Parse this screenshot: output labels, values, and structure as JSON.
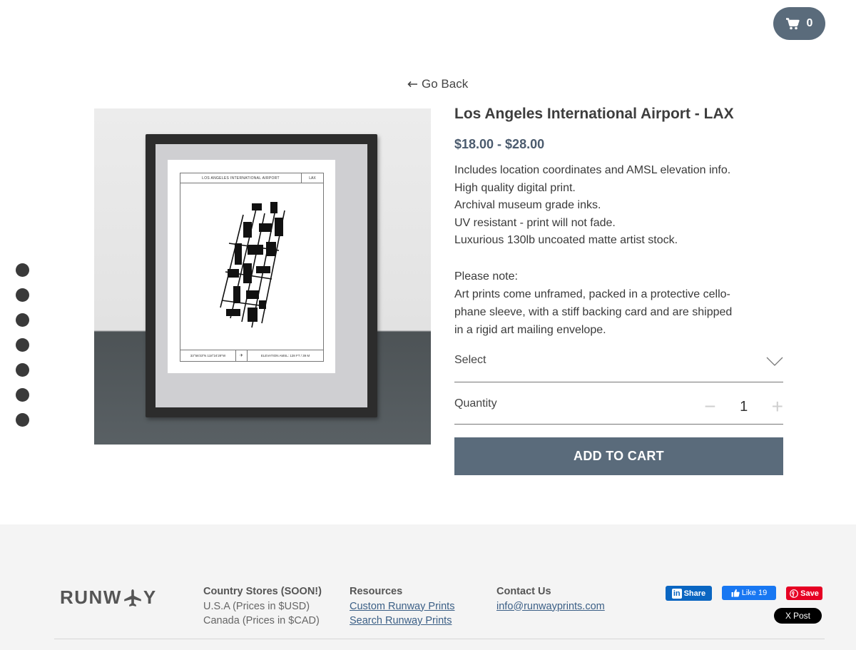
{
  "header": {
    "cart_count": "0"
  },
  "nav": {
    "go_back_label": "Go Back"
  },
  "product": {
    "title": "Los Angeles International Airport - LAX",
    "price": "$18.00 - $28.00",
    "description": [
      "Includes location coordinates and AMSL elevation info.",
      "High quality digital print.",
      "Archival museum grade inks.",
      "UV resistant - print will not fade.",
      "Luxurious 130lb uncoated matte artist stock."
    ],
    "note_heading": "Please note:",
    "note_lines": [
      "Art prints come unframed, packed in a protective cello-",
      "phane sleeve, with a stiff backing card and are shipped",
      "in a rigid art mailing envelope."
    ],
    "print": {
      "header_title": "LOS ANGELES INTERNATIONAL AIRPORT",
      "header_code": "LAX",
      "coordinates": "33°56'33\"N 118°24'29\"W",
      "elevation": "ELEVATION AMSL: 128 FT / 39 M"
    }
  },
  "options": {
    "select_label": "Select",
    "quantity_label": "Quantity",
    "quantity_value": "1",
    "minus": "−",
    "plus": "+"
  },
  "cta": {
    "add_to_cart": "ADD TO CART"
  },
  "gallery": {
    "dot_count": 7
  },
  "footer": {
    "logo_left": "RUNW",
    "logo_right": "Y",
    "stores": {
      "heading": "Country Stores (SOON!)",
      "items": [
        "U.S.A (Prices in $USD)",
        "Canada (Prices in $CAD)"
      ]
    },
    "resources": {
      "heading": "Resources",
      "links": [
        "Custom Runway Prints",
        "Search Runway Prints"
      ]
    },
    "contact": {
      "heading": "Contact Us",
      "email": "info@runwayprints.com"
    },
    "social": {
      "linkedin_prefix": "in",
      "linkedin": "Share",
      "facebook": "Like 19",
      "pinterest": "Save",
      "x": "Post",
      "x_logo": "X"
    }
  },
  "colors": {
    "accent": "#5a6b7b",
    "price": "#4b5b6e",
    "link": "#3b5f86"
  },
  "icons": [
    "cart-icon",
    "arrow-left-icon",
    "chevron-down-icon",
    "airplane-icon",
    "linkedin-icon",
    "facebook-thumb-icon",
    "pinterest-icon",
    "x-icon"
  ]
}
